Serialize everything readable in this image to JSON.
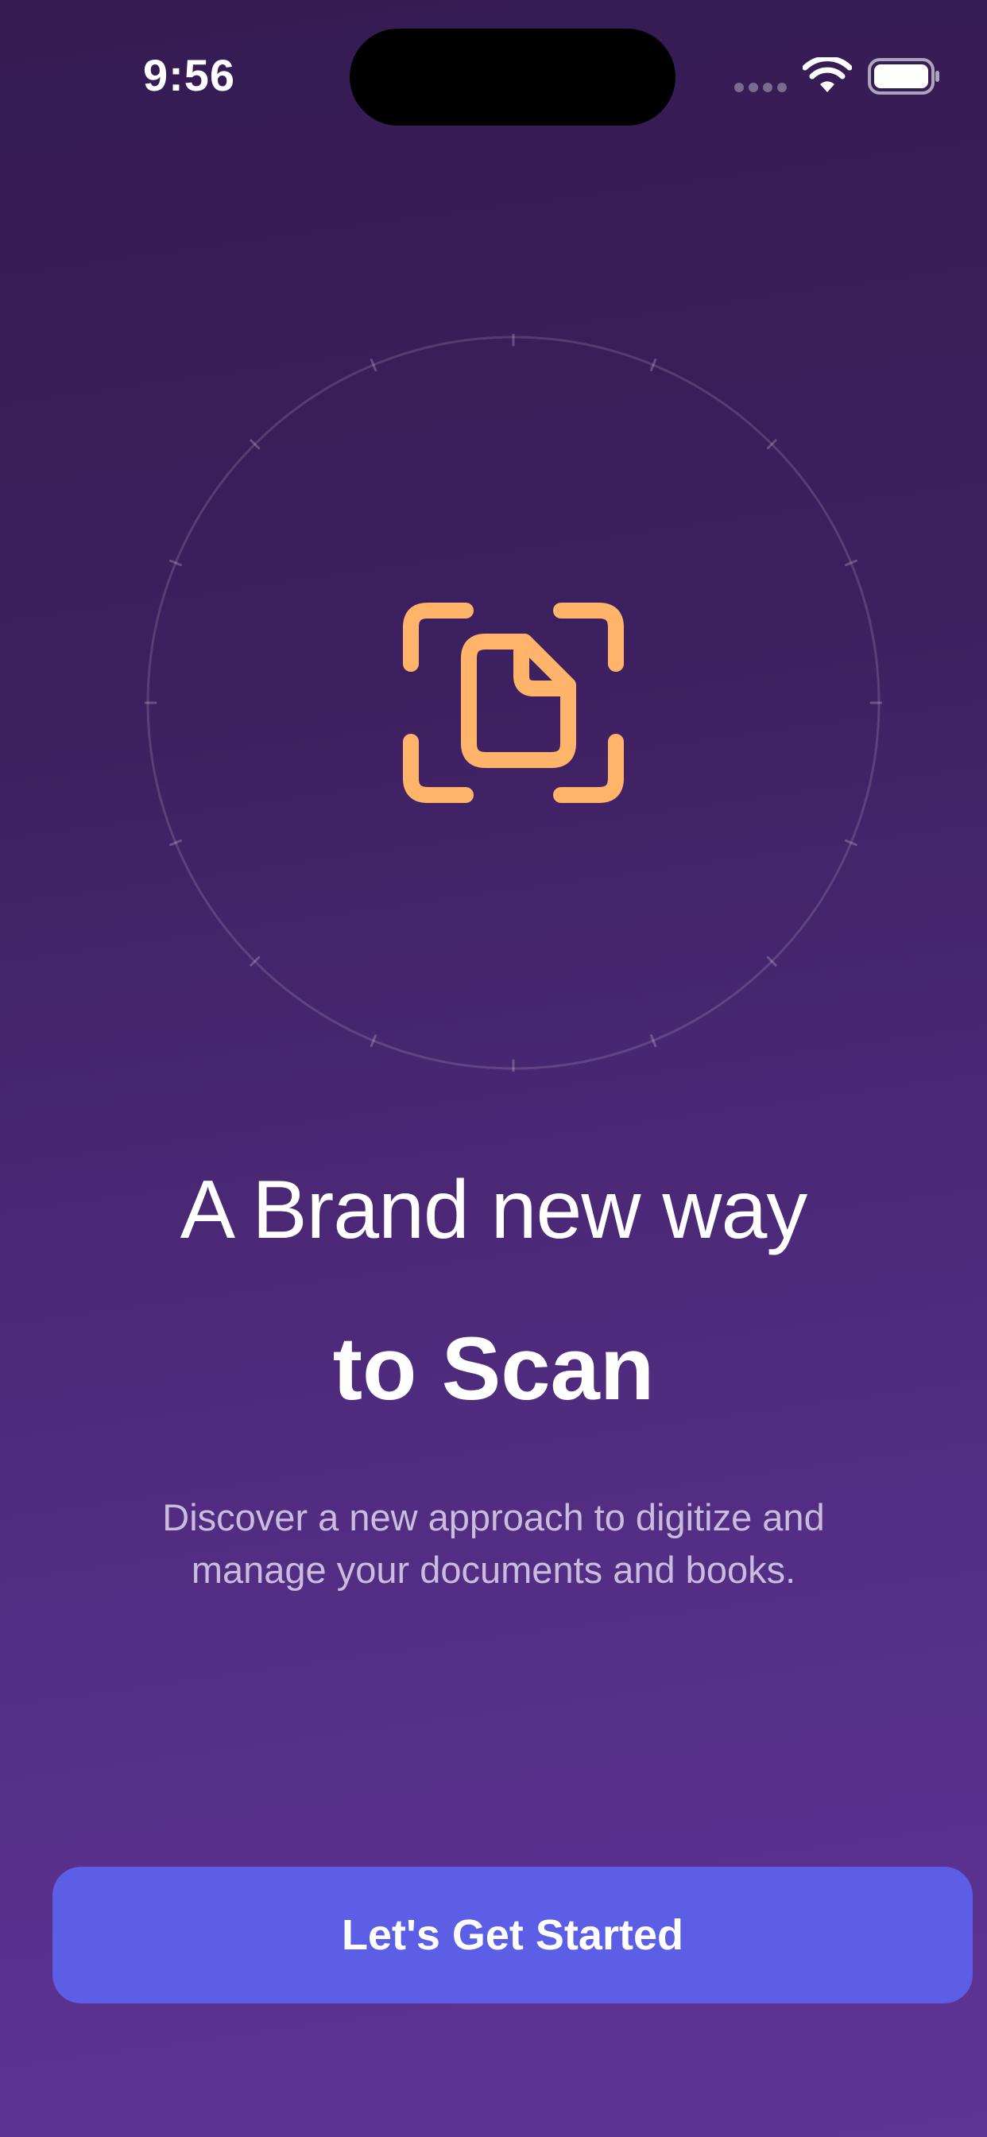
{
  "status_bar": {
    "time": "9:56",
    "icons": [
      "cellular-signal-icon",
      "wifi-icon",
      "battery-icon"
    ]
  },
  "hero": {
    "icon": "document-scan-icon",
    "icon_color": "#ffb46a"
  },
  "headline": {
    "line1": "A Brand new way",
    "line2": "to Scan"
  },
  "subtitle": "Discover a new approach to digitize and manage your documents and books.",
  "cta": {
    "label": "Let's Get Started",
    "color": "#5c5ee6"
  },
  "colors": {
    "background_top": "#351b52",
    "background_bottom": "#5f3296",
    "subtitle": "#c9bcdc"
  }
}
